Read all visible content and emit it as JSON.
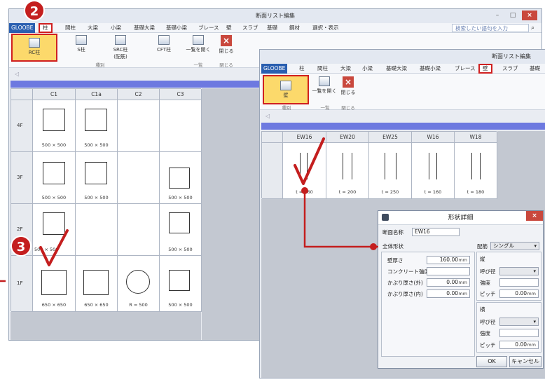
{
  "window1": {
    "title": "断面リスト編集",
    "min": "–",
    "max": "□",
    "close": "×",
    "menu": [
      "GLOOBE",
      "柱",
      "間柱",
      "大梁",
      "小梁",
      "基礎大梁",
      "基礎小梁",
      "ブレース",
      "壁",
      "スラブ",
      "基礎",
      "鋼材",
      "選択・表示"
    ],
    "search_placeholder": "検索したい語句を入力",
    "ribbon": {
      "rc": "RC柱",
      "s": "S柱",
      "src1": "SRC柱",
      "src2": "(配筋)",
      "cft": "CFT柱",
      "open_list": "一覧を開く",
      "close": "閉じる",
      "group_kind": "種別",
      "group_list": "一覧",
      "group_close": "閉じる"
    },
    "collapse_arrow": "◁",
    "columns": [
      "C1",
      "C1a",
      "C2",
      "C3"
    ],
    "rows": [
      {
        "floor": "4F",
        "sizes": [
          "500 × 500",
          "500 × 500",
          "",
          ""
        ]
      },
      {
        "floor": "3F",
        "sizes": [
          "500 × 500",
          "500 × 500",
          "",
          "500 × 500"
        ]
      },
      {
        "floor": "2F",
        "sizes": [
          "500 × 500",
          "",
          "",
          "500 × 500"
        ]
      },
      {
        "floor": "1F",
        "sizes": [
          "650 × 650",
          "650 × 650",
          "R = 500",
          "500 × 500"
        ]
      }
    ]
  },
  "window2": {
    "title": "断面リスト編集",
    "menu": [
      "GLOOBE",
      "柱",
      "間柱",
      "大梁",
      "小梁",
      "基礎大梁",
      "基礎小梁",
      "ブレース",
      "壁",
      "スラブ",
      "基礎"
    ],
    "ribbon": {
      "wall": "壁",
      "open_list": "一覧を開く",
      "close": "閉じる",
      "group_kind": "種別",
      "group_list": "一覧",
      "group_close": "閉じる"
    },
    "collapse_arrow": "◁",
    "columns": [
      "EW16",
      "EW20",
      "EW25",
      "W16",
      "W18"
    ],
    "thickness": [
      "t = 160",
      "t = 200",
      "t = 250",
      "t = 160",
      "t = 180"
    ]
  },
  "dialog": {
    "title": "形状詳細",
    "close": "×",
    "name_label": "断面名称",
    "name_value": "EW16",
    "overall_label": "全体形状",
    "rebar_label": "配筋",
    "rebar_value": "シングル",
    "thickness_label": "壁厚さ",
    "thickness_value": "160.00",
    "unit": "mm",
    "concrete_label": "コンクリート強度",
    "concrete_value": "",
    "cover_out_label": "かぶり厚さ(外)",
    "cover_out_value": "0.00",
    "cover_in_label": "かぶり厚さ(内)",
    "cover_in_value": "0.00",
    "vertical_label": "縦",
    "horizontal_label": "横",
    "diameter_label": "呼び径",
    "strength_label": "強度",
    "pitch_label": "ピッチ",
    "pitch_value": "0.00",
    "ok": "OK",
    "cancel": "キャンセル"
  },
  "badges": [
    "2",
    "3"
  ],
  "colors": {
    "accent_red": "#d02020",
    "bluebar": "#6d79e0",
    "active_yellow": "#fcd96b"
  }
}
